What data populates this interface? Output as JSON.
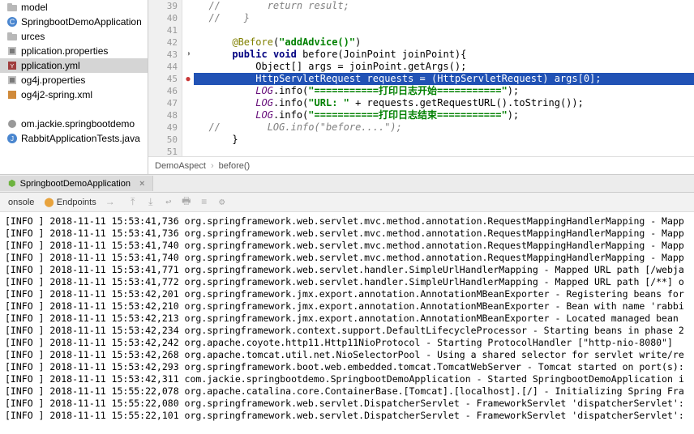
{
  "tree": {
    "items": [
      {
        "label": "model",
        "icon": "folder"
      },
      {
        "label": "SpringbootDemoApplication",
        "icon": "class"
      },
      {
        "label": "urces",
        "icon": "folder"
      },
      {
        "label": "pplication.properties",
        "icon": "props"
      },
      {
        "label": "pplication.yml",
        "icon": "yml",
        "selected": true
      },
      {
        "label": "og4j.properties",
        "icon": "props"
      },
      {
        "label": "og4j2-spring.xml",
        "icon": "xml"
      },
      {
        "label": "",
        "icon": ""
      },
      {
        "label": "om.jackie.springbootdemo",
        "icon": "pkg"
      },
      {
        "label": "RabbitApplicationTests.java",
        "icon": "java"
      }
    ]
  },
  "editor": {
    "gutter_start": 39,
    "lines": [
      {
        "n": 39,
        "type": "cmt",
        "text": "  //        return result;"
      },
      {
        "n": 40,
        "type": "cmt",
        "text": "  //    }"
      },
      {
        "n": 41,
        "type": "blank",
        "text": ""
      },
      {
        "n": 42,
        "type": "ann",
        "text": "      @Before(\"addAdvice()\")",
        "ann": "@Before",
        "str": "\"addAdvice()\""
      },
      {
        "n": 43,
        "type": "sig",
        "kw1": "public",
        "kw2": "void",
        "name": "before",
        "param": "(JoinPoint joinPoint){",
        "marker": "override"
      },
      {
        "n": 44,
        "type": "body",
        "text": "          Object[] args = joinPoint.getArgs();"
      },
      {
        "n": 45,
        "type": "hl",
        "text": "          HttpServletRequest requests = (HttpServletRequest) args[0];",
        "marker": "error"
      },
      {
        "n": 46,
        "type": "log",
        "static": "LOG",
        "call": ".info(",
        "str": "\"===========打印日志开始===========\"",
        "tail": ");"
      },
      {
        "n": 47,
        "type": "log",
        "static": "LOG",
        "call": ".info(",
        "str": "\"URL: \"",
        "mid": " + requests.getRequestURL().toString());"
      },
      {
        "n": 48,
        "type": "log",
        "static": "LOG",
        "call": ".info(",
        "str": "\"===========打印日志结束===========\"",
        "tail": ");"
      },
      {
        "n": 49,
        "type": "cmt",
        "text": "  //        LOG.info(\"before....\");"
      },
      {
        "n": 50,
        "type": "brace",
        "text": "      }"
      },
      {
        "n": 51,
        "type": "blank",
        "text": ""
      }
    ],
    "breadcrumb": {
      "cls": "DemoAspect",
      "meth": "before()"
    }
  },
  "run": {
    "tab_label": "SpringbootDemoApplication",
    "console_label": "onsole",
    "endpoints_label": "Endpoints"
  },
  "console_lines": [
    "[INFO ] 2018-11-11 15:53:41,736 org.springframework.web.servlet.mvc.method.annotation.RequestMappingHandlerMapping - Mapp",
    "[INFO ] 2018-11-11 15:53:41,736 org.springframework.web.servlet.mvc.method.annotation.RequestMappingHandlerMapping - Mapp",
    "[INFO ] 2018-11-11 15:53:41,740 org.springframework.web.servlet.mvc.method.annotation.RequestMappingHandlerMapping - Mapp",
    "[INFO ] 2018-11-11 15:53:41,740 org.springframework.web.servlet.mvc.method.annotation.RequestMappingHandlerMapping - Mapp",
    "[INFO ] 2018-11-11 15:53:41,771 org.springframework.web.servlet.handler.SimpleUrlHandlerMapping - Mapped URL path [/webja",
    "[INFO ] 2018-11-11 15:53:41,772 org.springframework.web.servlet.handler.SimpleUrlHandlerMapping - Mapped URL path [/**] o",
    "[INFO ] 2018-11-11 15:53:42,201 org.springframework.jmx.export.annotation.AnnotationMBeanExporter - Registering beans for",
    "[INFO ] 2018-11-11 15:53:42,210 org.springframework.jmx.export.annotation.AnnotationMBeanExporter - Bean with name 'rabbi",
    "[INFO ] 2018-11-11 15:53:42,213 org.springframework.jmx.export.annotation.AnnotationMBeanExporter - Located managed bean ",
    "[INFO ] 2018-11-11 15:53:42,234 org.springframework.context.support.DefaultLifecycleProcessor - Starting beans in phase 2",
    "[INFO ] 2018-11-11 15:53:42,242 org.apache.coyote.http11.Http11NioProtocol - Starting ProtocolHandler [\"http-nio-8080\"]",
    "[INFO ] 2018-11-11 15:53:42,268 org.apache.tomcat.util.net.NioSelectorPool - Using a shared selector for servlet write/re",
    "[INFO ] 2018-11-11 15:53:42,293 org.springframework.boot.web.embedded.tomcat.TomcatWebServer - Tomcat started on port(s):",
    "[INFO ] 2018-11-11 15:53:42,311 com.jackie.springbootdemo.SpringbootDemoApplication - Started SpringbootDemoApplication i",
    "[INFO ] 2018-11-11 15:55:22,078 org.apache.catalina.core.ContainerBase.[Tomcat].[localhost].[/] - Initializing Spring Fra",
    "[INFO ] 2018-11-11 15:55:22,080 org.springframework.web.servlet.DispatcherServlet - FrameworkServlet 'dispatcherServlet':",
    "[INFO ] 2018-11-11 15:55:22,101 org.springframework.web.servlet.DispatcherServlet - FrameworkServlet 'dispatcherServlet':"
  ]
}
